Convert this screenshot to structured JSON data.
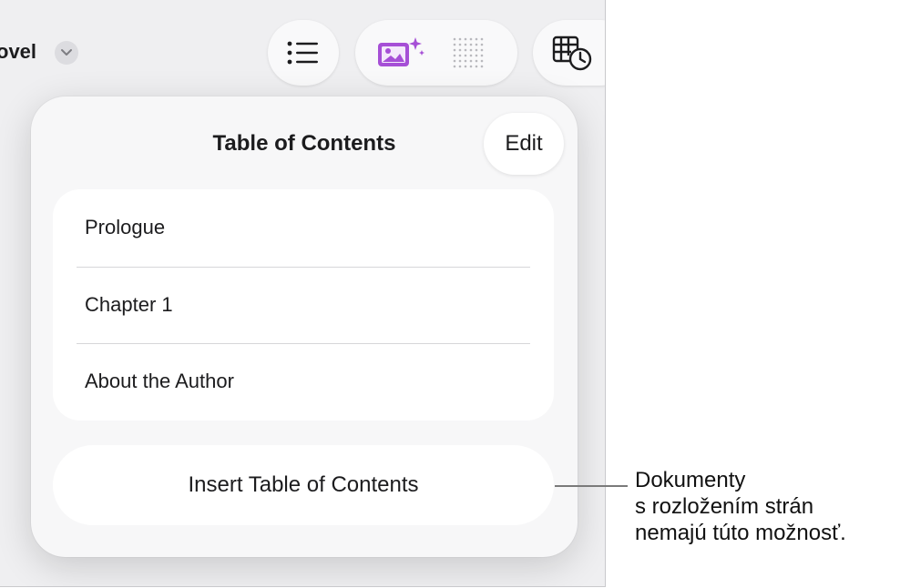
{
  "toolbar": {
    "doc_title": "ovel",
    "icons": [
      "chevron-down-icon",
      "list-icon",
      "image-sparkle-icon",
      "dot-grid-icon",
      "table-clock-icon"
    ]
  },
  "popover": {
    "title": "Table of Contents",
    "edit_label": "Edit",
    "items": [
      {
        "label": "Prologue"
      },
      {
        "label": "Chapter 1"
      },
      {
        "label": "About the Author"
      }
    ],
    "insert_label": "Insert Table of Contents"
  },
  "callout": {
    "lines": [
      "Dokumenty",
      "s rozložením strán",
      "nemajú túto možnosť."
    ]
  },
  "colors": {
    "accent_purple": "#a64fd6",
    "background": "#efeff1",
    "card": "#ffffff"
  }
}
